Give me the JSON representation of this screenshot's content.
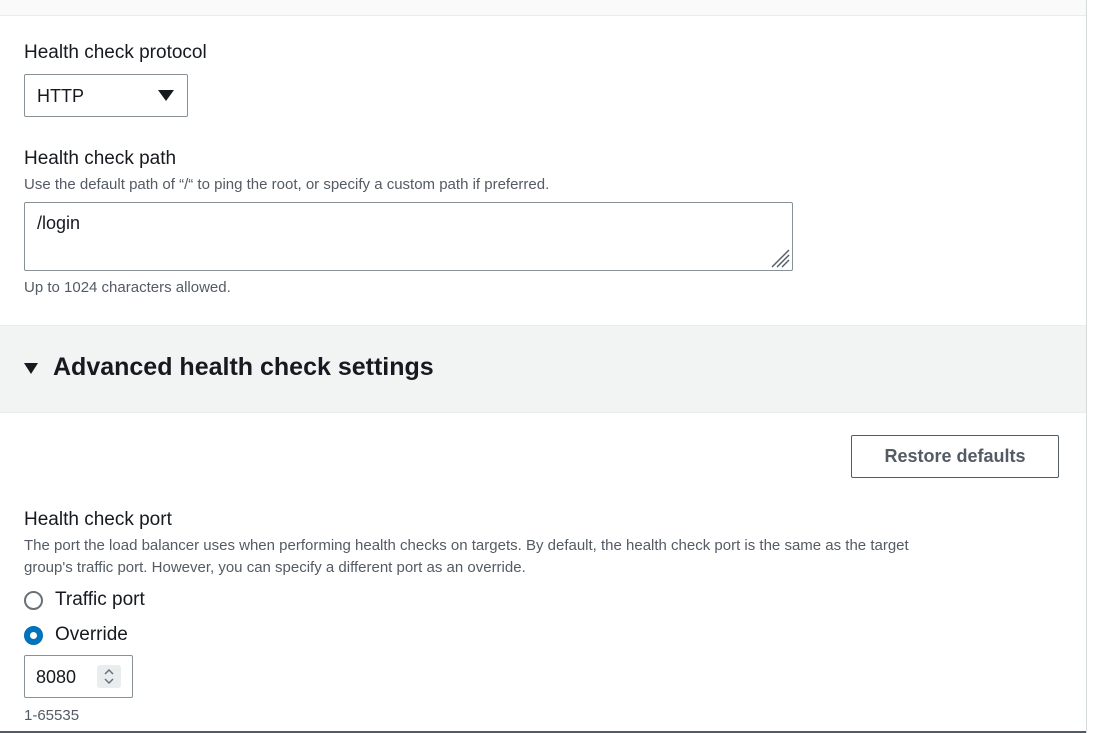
{
  "health_check": {
    "protocol": {
      "label": "Health check protocol",
      "selected": "HTTP",
      "caret_icon": "caret-down-icon"
    },
    "path": {
      "label": "Health check path",
      "description": "Use the default path of “/“ to ping the root, or specify a custom path if preferred.",
      "value": "/login",
      "constraint": "Up to 1024 characters allowed."
    }
  },
  "advanced": {
    "title": "Advanced health check settings",
    "toggle_icon": "caret-down-icon",
    "restore_button": "Restore defaults",
    "port": {
      "label": "Health check port",
      "description_line1": "The port the load balancer uses when performing health checks on targets. By default, the health check port is the same as the target",
      "description_line2": "group's traffic port. However, you can specify a different port as an override.",
      "options": [
        {
          "label": "Traffic port",
          "selected": false
        },
        {
          "label": "Override",
          "selected": true
        }
      ],
      "value": "8080",
      "range_hint": "1-65535"
    }
  },
  "colors": {
    "accent": "#0073bb",
    "text": "#16191f",
    "muted": "#545b64",
    "section_bg": "#f2f3f3"
  }
}
